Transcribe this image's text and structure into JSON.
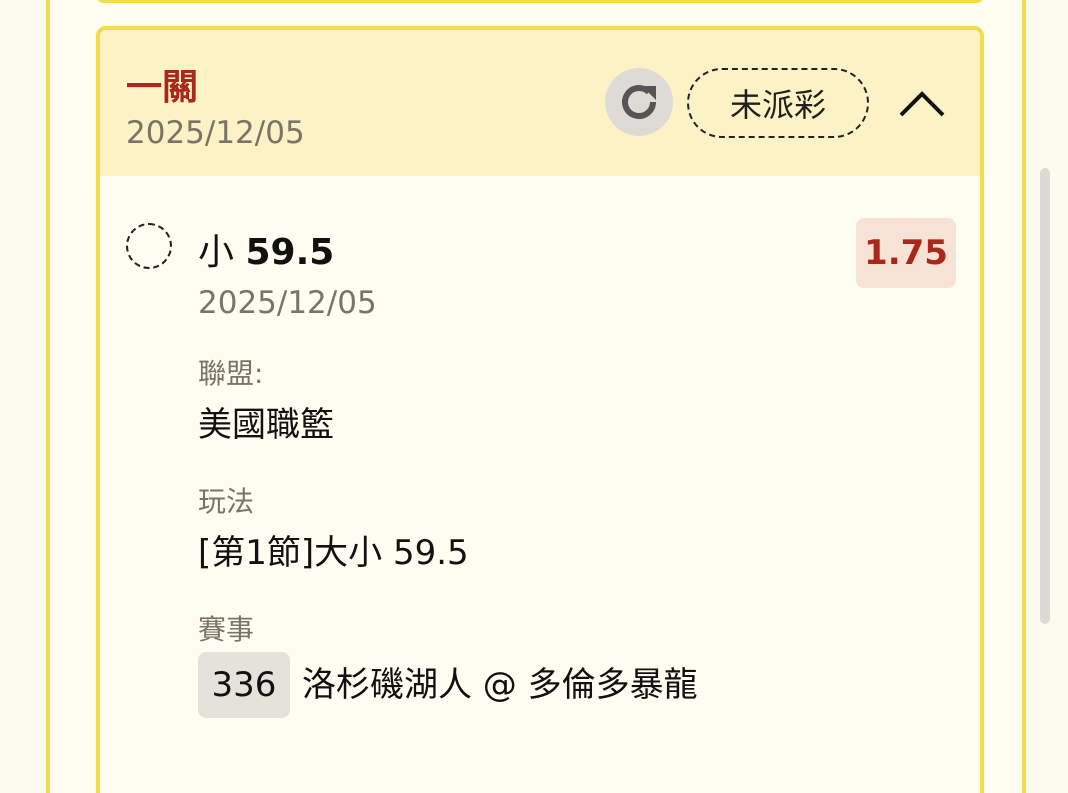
{
  "bet_card": {
    "header": {
      "title": "一關",
      "date": "2025/12/05",
      "status": "未派彩",
      "refresh_icon": "refresh-icon",
      "collapse_icon": "chevron-up-icon"
    },
    "selection": {
      "label": "小",
      "value": "59.5",
      "date": "2025/12/05",
      "odds": "1.75"
    },
    "fields": {
      "league_label": "聯盟:",
      "league_value": "美國職籃",
      "play_label": "玩法",
      "play_value": "[第1節]大小 59.5",
      "match_label": "賽事",
      "match_number": "336",
      "match_name": "洛杉磯湖人 @ 多倫多暴龍"
    }
  },
  "colors": {
    "accent_border": "#f2dc4a",
    "header_bg": "#fdf2c6",
    "title_red": "#a8281c",
    "odds_bg": "#f6e3d6"
  }
}
